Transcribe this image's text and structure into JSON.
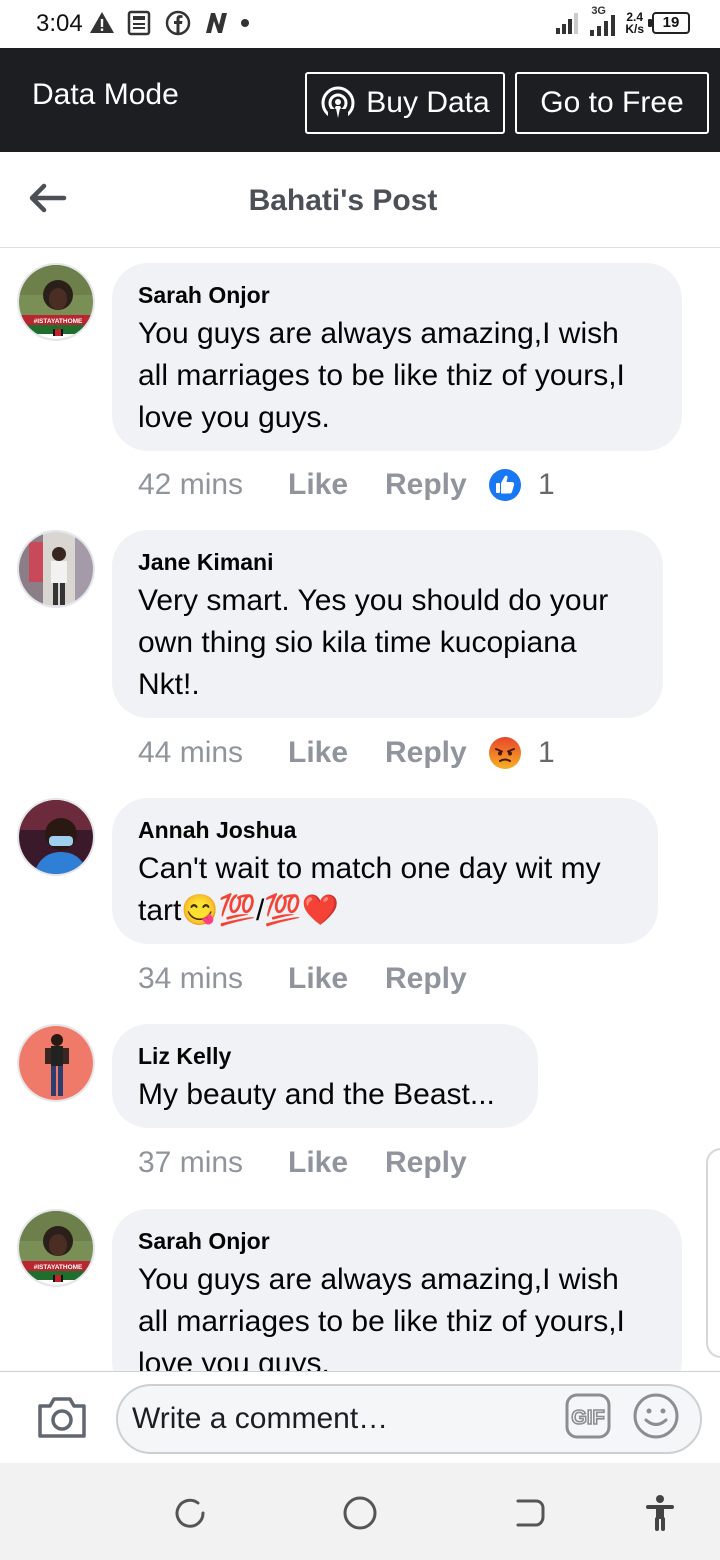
{
  "status_bar": {
    "time": "3:04",
    "network_type": "3G",
    "speed_value": "2.4",
    "speed_unit": "K/s",
    "battery": "19",
    "icons": [
      "warning-icon",
      "news-icon",
      "facebook-icon",
      "n-app-icon",
      "dot-icon",
      "signal-icon",
      "signal-3g-icon",
      "battery-icon"
    ]
  },
  "data_mode": {
    "label": "Data Mode",
    "buy_label": "Buy Data",
    "free_label": "Go to Free"
  },
  "header": {
    "title": "Bahati's Post"
  },
  "comments": [
    {
      "author": "Sarah Onjor",
      "text": "You guys are always amazing,I wish all marriages to be like thiz of yours,I love you guys.",
      "time": "42 mins",
      "like": "Like",
      "reply": "Reply",
      "reaction": "like-icon",
      "reaction_count": "1",
      "avatar_caption": "#ISTAYATHOME"
    },
    {
      "author": "Jane Kimani",
      "text": "Very smart. Yes you should do your own thing sio kila time kucopiana Nkt!.",
      "time": "44 mins",
      "like": "Like",
      "reply": "Reply",
      "reaction": "angry-icon",
      "reaction_count": "1"
    },
    {
      "author": "Annah Joshua",
      "text": "Can't wait to match one day wit my tart😋💯/💯❤️",
      "time": "34 mins",
      "like": "Like",
      "reply": "Reply"
    },
    {
      "author": "Liz Kelly",
      "text": "My beauty and the Beast...",
      "time": "37 mins",
      "like": "Like",
      "reply": "Reply"
    },
    {
      "author": "Sarah Onjor",
      "text": "You guys are always amazing,I wish all marriages to be like thiz of yours,I love you guys.",
      "avatar_caption": "#ISTAYATHOME"
    }
  ],
  "composer": {
    "placeholder": "Write a comment…",
    "gif_label": "GIF"
  },
  "colors": {
    "data_bar": "#1c1e21",
    "bubble": "#f0f2f5",
    "meta_text": "#90949c",
    "like_blue": "#1877f2",
    "angry_orange": "#f0821e"
  }
}
